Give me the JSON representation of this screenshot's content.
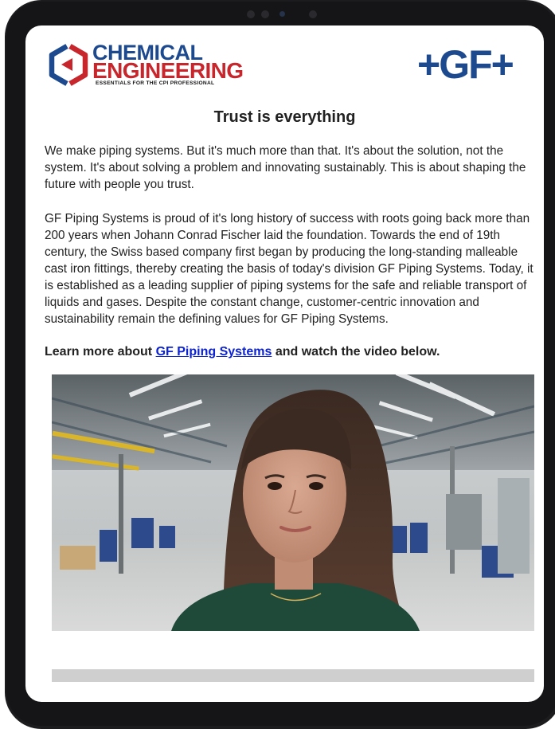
{
  "brand": {
    "ce_line1": "CHEMICAL",
    "ce_line2": "ENGINEERING",
    "ce_tagline": "ESSENTIALS FOR THE CPI PROFESSIONAL",
    "gf_logo": "+GF+"
  },
  "content": {
    "headline": "Trust is everything",
    "paragraph1": "We make piping systems. But it's much more than that. It's about the solution, not the system. It's about solving a problem and innovating sustainably. This is about shaping the future with people you trust.",
    "paragraph2": "GF Piping Systems is proud of it's long history of success with roots going back more than 200 years when Johann Conrad Fischer laid the foundation. Towards the end of 19th century, the Swiss based company first began by producing the long-standing malleable cast iron fittings, thereby creating the basis of today's division GF Piping Systems. Today, it is established as a leading supplier of piping systems for the safe and reliable transport of liquids and gases. Despite the constant change, customer-centric innovation and sustainability remain the defining values for GF Piping Systems.",
    "cta_before": "Learn more about ",
    "cta_link": "GF Piping Systems",
    "cta_after": " and watch the video below."
  },
  "colors": {
    "brand_blue": "#1d4a8f",
    "brand_red": "#c8262d",
    "link": "#0b22d4"
  }
}
